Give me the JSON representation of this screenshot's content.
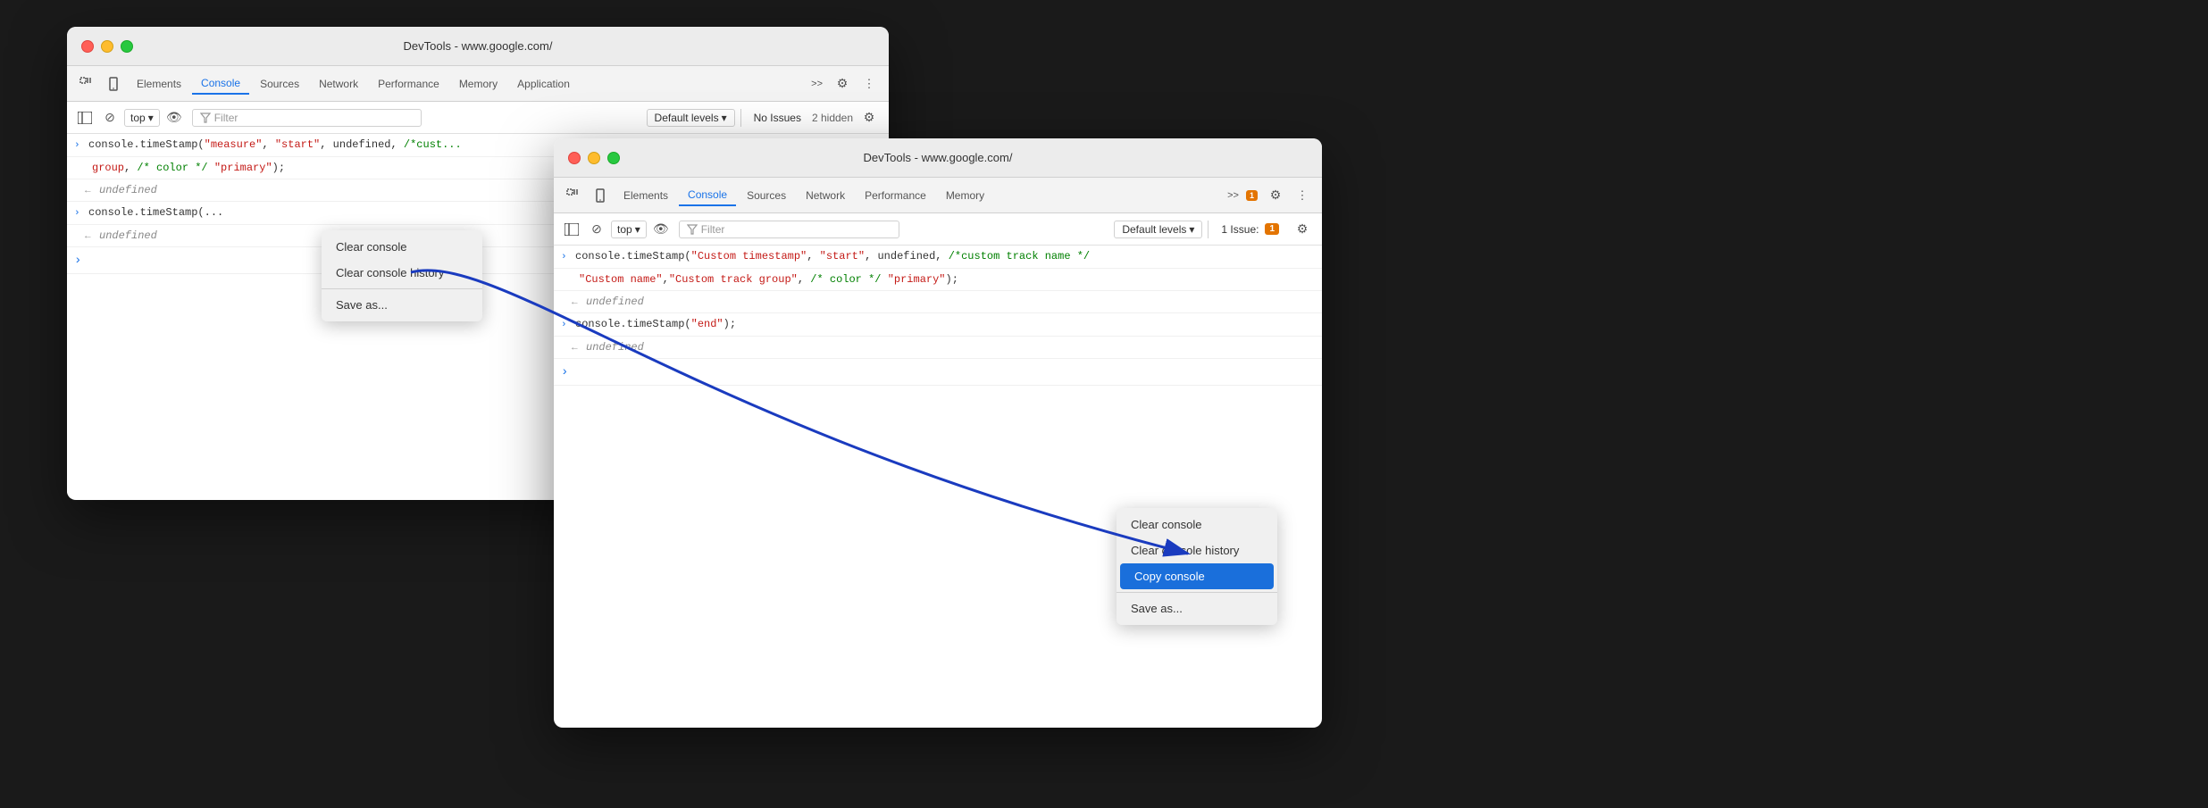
{
  "window1": {
    "title": "DevTools - www.google.com/",
    "tabs": [
      "Elements",
      "Console",
      "Sources",
      "Network",
      "Performance",
      "Memory",
      "Application"
    ],
    "active_tab": "Console",
    "console_toolbar": {
      "top_label": "top",
      "filter_placeholder": "Filter",
      "levels_label": "Default levels",
      "issues_label": "No Issues",
      "hidden_label": "2 hidden"
    },
    "console_lines": [
      {
        "type": "input",
        "content": "console.timeStamp(\"measure\", \"start\", undefined, /*cust...",
        "continuation": "group\", /* color */ \"primary\");"
      },
      {
        "type": "output",
        "content": "undefined"
      },
      {
        "type": "input",
        "content": "console.timeStamp(..."
      },
      {
        "type": "output",
        "content": "undefined"
      },
      {
        "type": "empty"
      }
    ],
    "context_menu": {
      "items": [
        "Clear console",
        "Clear console history",
        "Save as..."
      ]
    }
  },
  "window2": {
    "title": "DevTools - www.google.com/",
    "tabs": [
      "Elements",
      "Console",
      "Sources",
      "Network",
      "Performance",
      "Memory"
    ],
    "active_tab": "Console",
    "badge_count": "1",
    "console_toolbar": {
      "top_label": "top",
      "filter_placeholder": "Filter",
      "levels_label": "Default levels",
      "issues_label": "1 Issue:",
      "issue_badge": "1"
    },
    "console_lines": [
      {
        "type": "input",
        "content_before": "console.timeStamp(",
        "string1": "\"Custom timestamp\"",
        "content_mid1": ", ",
        "string2": "\"start\"",
        "content_mid2": ", undefined, ",
        "comment": "/*custom track name */",
        "content_line2_before": "\"Custom name\"",
        "string3": ", ",
        "content_line2_mid": "\"Custom track group\"",
        "comment2": ", /* color */",
        "string4": " \"primary\"",
        "content_end": ");"
      },
      {
        "type": "output",
        "content": "undefined"
      },
      {
        "type": "input",
        "content": "console.timeStamp(\"end\");"
      },
      {
        "type": "output",
        "content": "undefined"
      },
      {
        "type": "empty"
      }
    ],
    "context_menu": {
      "items": [
        "Clear console",
        "Clear console history",
        "Copy console",
        "Save as..."
      ],
      "highlighted": "Copy console"
    }
  },
  "arrow": {
    "label": "arrow pointing to Copy console"
  },
  "icons": {
    "selector": "⚙",
    "dots": "⋮",
    "more": ">>",
    "filter": "▽",
    "eye": "👁",
    "inspect": "⬚",
    "no_entry": "⊘",
    "chevron_down": "▾",
    "chevron_right": "›",
    "arrow_left": "←"
  }
}
